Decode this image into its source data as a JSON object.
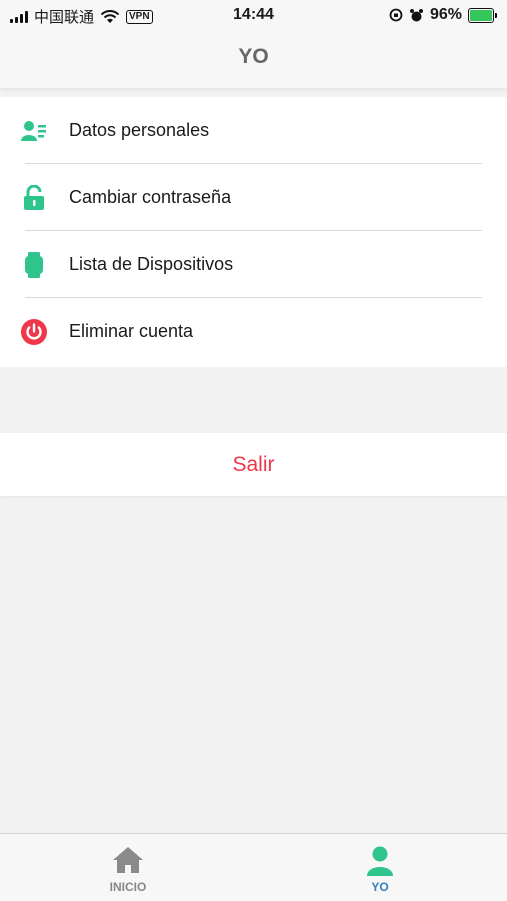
{
  "status_bar": {
    "carrier": "中国联通",
    "vpn": "VPN",
    "time": "14:44",
    "battery": "96%"
  },
  "header": {
    "title": "YO"
  },
  "menu": {
    "items": [
      {
        "label": "Datos personales",
        "icon": "profile-card-icon"
      },
      {
        "label": "Cambiar contraseña",
        "icon": "lock-icon"
      },
      {
        "label": "Lista de Dispositivos",
        "icon": "watch-icon"
      },
      {
        "label": "Eliminar cuenta",
        "icon": "power-icon"
      }
    ]
  },
  "logout": {
    "label": "Salir"
  },
  "tabbar": {
    "tabs": [
      {
        "label": "INICIO",
        "icon": "home-icon",
        "active": false
      },
      {
        "label": "YO",
        "icon": "person-icon",
        "active": true
      }
    ]
  },
  "colors": {
    "accent_green": "#2ec48c",
    "danger_red": "#f0364a",
    "active_tab_blue": "#2f7fc1"
  }
}
